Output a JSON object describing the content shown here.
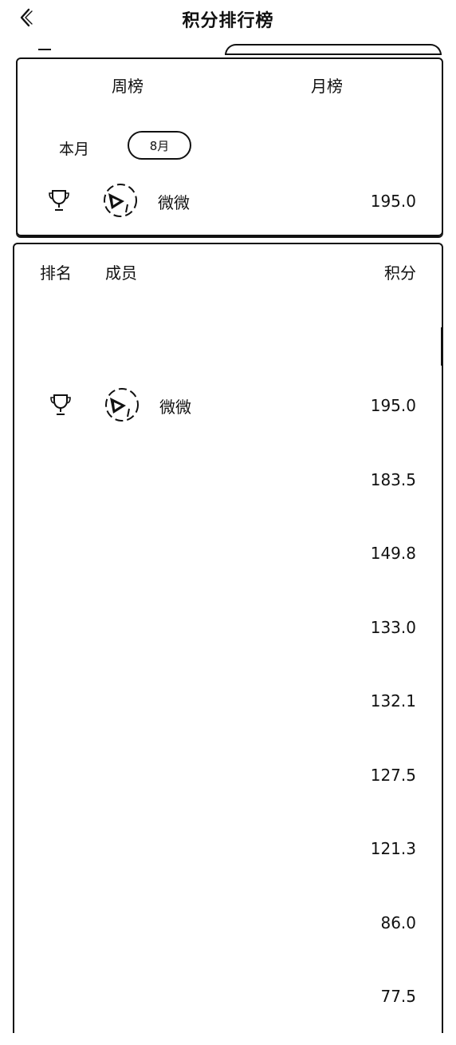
{
  "header": {
    "title": "积分排行榜"
  },
  "tabs": [
    {
      "label": "周榜"
    },
    {
      "label": "月榜"
    }
  ],
  "period": {
    "label": "本月",
    "selected": "8月"
  },
  "my_entry": {
    "name": "微微",
    "score": "195.0"
  },
  "table": {
    "columns": [
      "排名",
      "成员",
      "积分"
    ],
    "rows": [
      {
        "name": "微微",
        "score": "195.0"
      },
      {
        "name": "",
        "score": "183.5"
      },
      {
        "name": "",
        "score": "149.8"
      },
      {
        "name": "",
        "score": "133.0"
      },
      {
        "name": "",
        "score": "132.1"
      },
      {
        "name": "",
        "score": "127.5"
      },
      {
        "name": "",
        "score": "121.3"
      },
      {
        "name": "",
        "score": "86.0"
      },
      {
        "name": "",
        "score": "77.5"
      }
    ]
  },
  "icons": {
    "back": "chevron-left-icon",
    "trophy": "trophy-icon",
    "avatar": "avatar-icon"
  }
}
